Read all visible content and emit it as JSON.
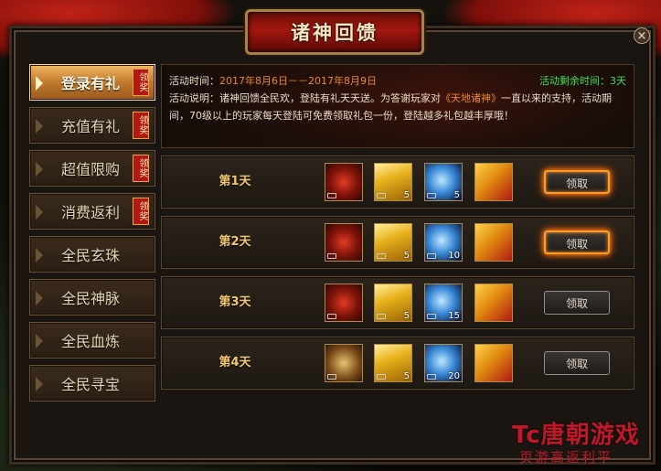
{
  "window": {
    "title": "诸神回馈",
    "close_label": "×"
  },
  "tabs": [
    {
      "label": "登录有礼",
      "badge": "领奖",
      "active": true
    },
    {
      "label": "充值有礼",
      "badge": "领奖",
      "active": false
    },
    {
      "label": "超值限购",
      "badge": "领奖",
      "active": false
    },
    {
      "label": "消费返利",
      "badge": "领奖",
      "active": false
    },
    {
      "label": "全民玄珠",
      "badge": "",
      "active": false
    },
    {
      "label": "全民神脉",
      "badge": "",
      "active": false
    },
    {
      "label": "全民血炼",
      "badge": "",
      "active": false
    },
    {
      "label": "全民寻宝",
      "badge": "",
      "active": false
    }
  ],
  "info": {
    "time_label": "活动时间：",
    "time_value": "2017年8月6日－－2017年8月9日",
    "remain_label": "活动剩余时间：",
    "remain_value": "3天",
    "desc_label": "活动说明：",
    "desc_part1": "诸神回馈全民欢，登陆有礼天天送。为答谢玩家对",
    "desc_game": "《天地诸神》",
    "desc_part2": "一直以来的支持，活动期间，70级以上的玩家每天登陆可免费领取礼包一份，登陆越多礼包越丰厚哦！"
  },
  "rows": [
    {
      "day": "第1天",
      "items": [
        {
          "icon": "mask-icon",
          "count": ""
        },
        {
          "icon": "gold-ingot-icon",
          "count": "5"
        },
        {
          "icon": "blue-orb-icon",
          "count": "5"
        },
        {
          "icon": "gift-box-icon",
          "count": ""
        }
      ],
      "button": "领取",
      "highlighted": true
    },
    {
      "day": "第2天",
      "items": [
        {
          "icon": "mask-icon",
          "count": ""
        },
        {
          "icon": "gold-ingot-icon",
          "count": "5"
        },
        {
          "icon": "blue-orb-icon",
          "count": "10"
        },
        {
          "icon": "gift-box-icon",
          "count": ""
        }
      ],
      "button": "领取",
      "highlighted": true
    },
    {
      "day": "第3天",
      "items": [
        {
          "icon": "mask-icon",
          "count": ""
        },
        {
          "icon": "gold-ingot-icon",
          "count": "5"
        },
        {
          "icon": "blue-orb-icon",
          "count": "15"
        },
        {
          "icon": "gift-box-icon",
          "count": ""
        }
      ],
      "button": "领取",
      "highlighted": false
    },
    {
      "day": "第4天",
      "items": [
        {
          "icon": "skill-book-icon",
          "count": ""
        },
        {
          "icon": "gold-ingot-icon",
          "count": "5"
        },
        {
          "icon": "blue-orb-icon",
          "count": "20"
        },
        {
          "icon": "gift-box-icon",
          "count": ""
        }
      ],
      "button": "领取",
      "highlighted": false
    }
  ],
  "watermark": {
    "brand": "Tc唐朝游戏",
    "tagline": "页游高返利平"
  },
  "colors": {
    "accent_orange": "#e8892c",
    "remain_green": "#3ee05a",
    "title_red": "#a3170e",
    "day_gold": "#f2c870"
  }
}
